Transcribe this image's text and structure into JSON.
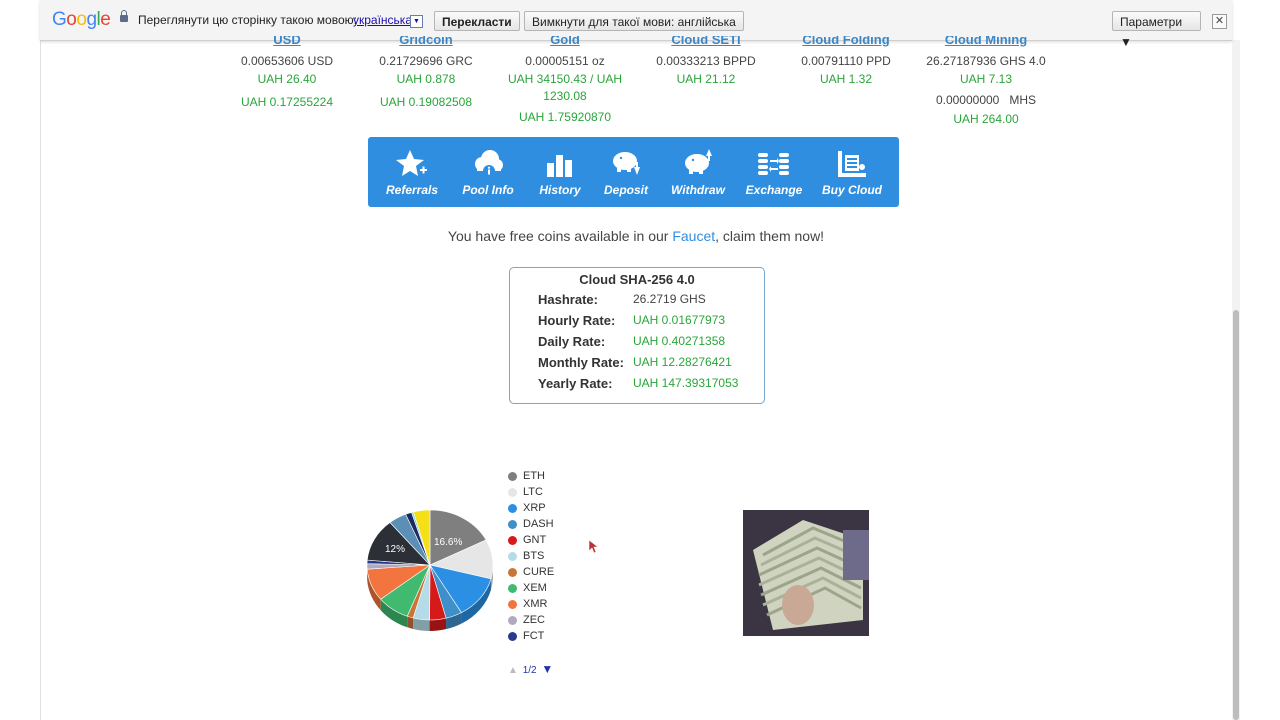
{
  "translate_bar": {
    "logo": "Google",
    "prompt": "Переглянути цю сторінку такою мовою:",
    "language": "українська",
    "translate_button": "Перекласти",
    "never_button": "Вимкнути для такої мови: англійська",
    "options_button": "Параметри ▼",
    "close": "✕"
  },
  "currencies": [
    {
      "name": "USD",
      "amount": "0.00653606 USD",
      "uah": "UAH 26.40",
      "uah2": "UAH 0.17255224"
    },
    {
      "name": "Gridcoin",
      "amount": "0.21729696 GRC",
      "uah": "UAH 0.878",
      "uah2": "UAH 0.19082508"
    },
    {
      "name": "Gold",
      "amount": "0.00005151 oz",
      "uah": "UAH 34150.43 / UAH 1230.08",
      "uah2": "UAH 1.75920870"
    },
    {
      "name": "Cloud SETI",
      "amount": "0.00333213 BPPD",
      "uah": "UAH 21.12",
      "uah2": ""
    },
    {
      "name": "Cloud Folding",
      "amount": "0.00791110 PPD",
      "uah": "UAH 1.32",
      "uah2": ""
    },
    {
      "name": "Cloud Mining",
      "amount": "26.27187936 GHS 4.0",
      "uah": "UAH 7.13",
      "extra": "0.00000000   MHS",
      "uah2": "UAH 264.00"
    }
  ],
  "nav": [
    "Referrals",
    "Pool Info",
    "History",
    "Deposit",
    "Withdraw",
    "Exchange",
    "Buy Cloud"
  ],
  "faucet": {
    "before": "You have free coins available in our ",
    "link": "Faucet",
    "after": ", claim them now!"
  },
  "cloud": {
    "title": "Cloud SHA-256 4.0",
    "rows": [
      {
        "label": "Hashrate:",
        "value": "26.2719 GHS"
      },
      {
        "label": "Hourly Rate:",
        "value": "UAH 0.01677973"
      },
      {
        "label": "Daily Rate:",
        "value": "UAH 0.40271358"
      },
      {
        "label": "Monthly Rate:",
        "value": "UAH 12.28276421"
      },
      {
        "label": "Yearly Rate:",
        "value": "UAH 147.39317053"
      }
    ]
  },
  "pie": {
    "label_a": "16.6%",
    "label_b": "12%",
    "slices": [
      {
        "name": "ETH",
        "pct": 16.6,
        "color": "#7f7f7f"
      },
      {
        "name": "LTC",
        "pct": 11,
        "color": "#e6e6e6"
      },
      {
        "name": "XRP",
        "pct": 12,
        "color": "#2b8fe3"
      },
      {
        "name": "DASH",
        "pct": 4,
        "color": "#3f8fca"
      },
      {
        "name": "GNT",
        "pct": 4,
        "color": "#d61a1a"
      },
      {
        "name": "BTS",
        "pct": 4,
        "color": "#b5dbe8"
      },
      {
        "name": "CURE",
        "pct": 1.5,
        "color": "#c9753a"
      },
      {
        "name": "XEM",
        "pct": 8,
        "color": "#3fba6f"
      },
      {
        "name": "XMR",
        "pct": 9,
        "color": "#f2743e"
      },
      {
        "name": "ZEC",
        "pct": 1.5,
        "color": "#b0a9c0"
      },
      {
        "name": "FCT",
        "pct": 1,
        "color": "#283a8c"
      },
      {
        "name": "",
        "pct": 12,
        "color": "#2c2f36"
      },
      {
        "name": "",
        "pct": 4.4,
        "color": "#5b8fb5"
      },
      {
        "name": "",
        "pct": 1.5,
        "color": "#1d2a5e"
      },
      {
        "name": "",
        "pct": 0.5,
        "color": "#7fd3e6"
      },
      {
        "name": "",
        "pct": 4,
        "color": "#f5e017"
      }
    ]
  },
  "legend": [
    "ETH",
    "LTC",
    "XRP",
    "DASH",
    "GNT",
    "BTS",
    "CURE",
    "XEM",
    "XMR",
    "ZEC",
    "FCT"
  ],
  "legend_colors": [
    "#7f7f7f",
    "#e6e6e6",
    "#2b8fe3",
    "#3f8fca",
    "#d61a1a",
    "#b5dbe8",
    "#c9753a",
    "#3fba6f",
    "#f2743e",
    "#b0a9c0",
    "#283a8c"
  ],
  "pager": {
    "up": "▲",
    "page": "1/2",
    "down": "▼"
  }
}
